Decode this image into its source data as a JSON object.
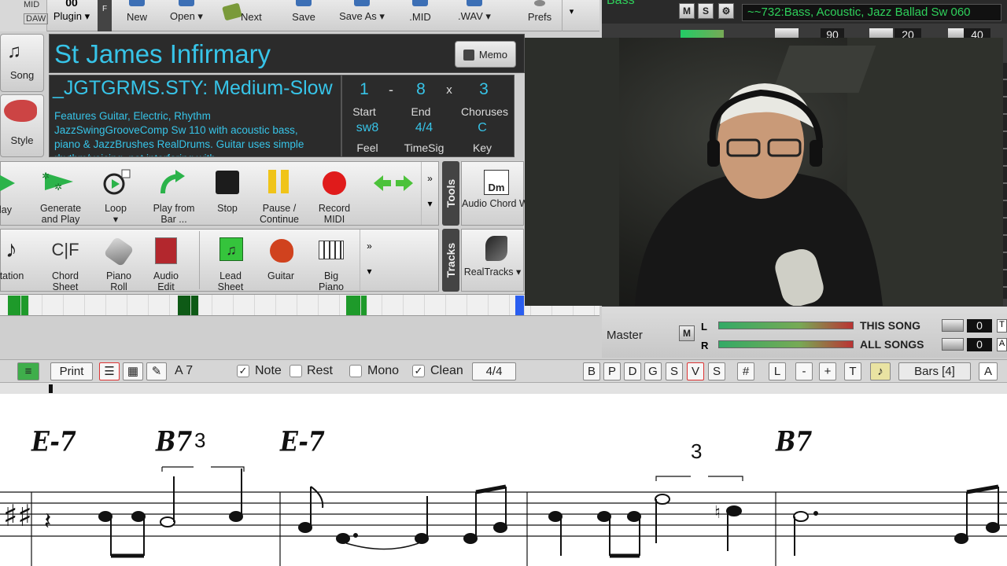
{
  "toolbar": {
    "plugin_label": "Plugin ▾",
    "daw_label": "DAW",
    "mid_label": "MID",
    "top_value": "00",
    "buttons": [
      {
        "label": "New"
      },
      {
        "label": "Open ▾"
      },
      {
        "label": "Next"
      },
      {
        "label": "Save"
      },
      {
        "label": "Save As ▾"
      },
      {
        "label": ".MID"
      },
      {
        "label": ".WAV ▾"
      },
      {
        "label": "Prefs"
      }
    ]
  },
  "song": {
    "title": "St James Infirmary",
    "memo_label": "Memo",
    "song_btn": "Song",
    "style_btn": "Style"
  },
  "style": {
    "name": "_JGTGRMS.STY: Medium-Slow",
    "description": "Features Guitar, Electric, Rhythm JazzSwingGrooveComp Sw 110 with acoustic bass, piano & JazzBrushes RealDrums. Guitar uses simple rhythm/voicing, not interfering with"
  },
  "info": {
    "start": "1",
    "dash": "-",
    "end": "8",
    "x": "x",
    "choruses": "3",
    "start_lbl": "Start",
    "end_lbl": "End",
    "choruses_lbl": "Choruses",
    "feel": "sw8",
    "timesig": "4/4",
    "key": "C",
    "feel_lbl": "Feel",
    "timesig_lbl": "TimeSig",
    "key_lbl": "Key"
  },
  "transport": [
    {
      "label": "Play"
    },
    {
      "label": "Generate\nand Play"
    },
    {
      "label": "Loop\n▾"
    },
    {
      "label": "Play from\nBar ..."
    },
    {
      "label": "Stop"
    },
    {
      "label": "Pause /\nContinue"
    },
    {
      "label": "Record\nMIDI"
    }
  ],
  "windows": [
    {
      "label": "Notation"
    },
    {
      "label": "Chord\nSheet"
    },
    {
      "label": "Piano\nRoll"
    },
    {
      "label": "Audio\nEdit"
    },
    {
      "label": "Lead\nSheet"
    },
    {
      "label": "Guitar"
    },
    {
      "label": "Big\nPiano"
    }
  ],
  "side_tabs": {
    "tools": "Tools",
    "tracks": "Tracks",
    "more": "»",
    "arrow_down": "▾"
  },
  "wizard": {
    "label": "Audio Chord Wizard",
    "icon_text": "Dm"
  },
  "realtracks": {
    "label": "RealTracks ▾"
  },
  "mixer": {
    "track_name": "Bass",
    "track_desc": "~~732:Bass, Acoustic, Jazz Ballad Sw 060",
    "m": "M",
    "s": "S",
    "vol": "90",
    "pan": "20",
    "rev": "40",
    "master_label": "Master",
    "l": "L",
    "r": "R",
    "this_song": "THIS SONG",
    "all_songs": "ALL SONGS",
    "this_val": "0",
    "all_val": "0",
    "t": "T",
    "a": "A"
  },
  "notation_bar": {
    "print": "Print",
    "key_label": "A 7",
    "note": "Note",
    "rest": "Rest",
    "mono": "Mono",
    "clean": "Clean",
    "check": "✓",
    "timesig": "4/4",
    "letters": [
      "B",
      "P",
      "D",
      "G",
      "S",
      "V",
      "S"
    ],
    "sharp": "#",
    "l": "L",
    "minus": "-",
    "plus": "+",
    "t": "T",
    "bars": "Bars [4]"
  },
  "score": {
    "chords": [
      "E-7",
      "B7",
      "E-7",
      "B7"
    ],
    "triplet": "3"
  },
  "colors": {
    "accent": "#37c4e8",
    "mixer_green": "#2fd05b",
    "strip_green": "#1e9a2a"
  }
}
